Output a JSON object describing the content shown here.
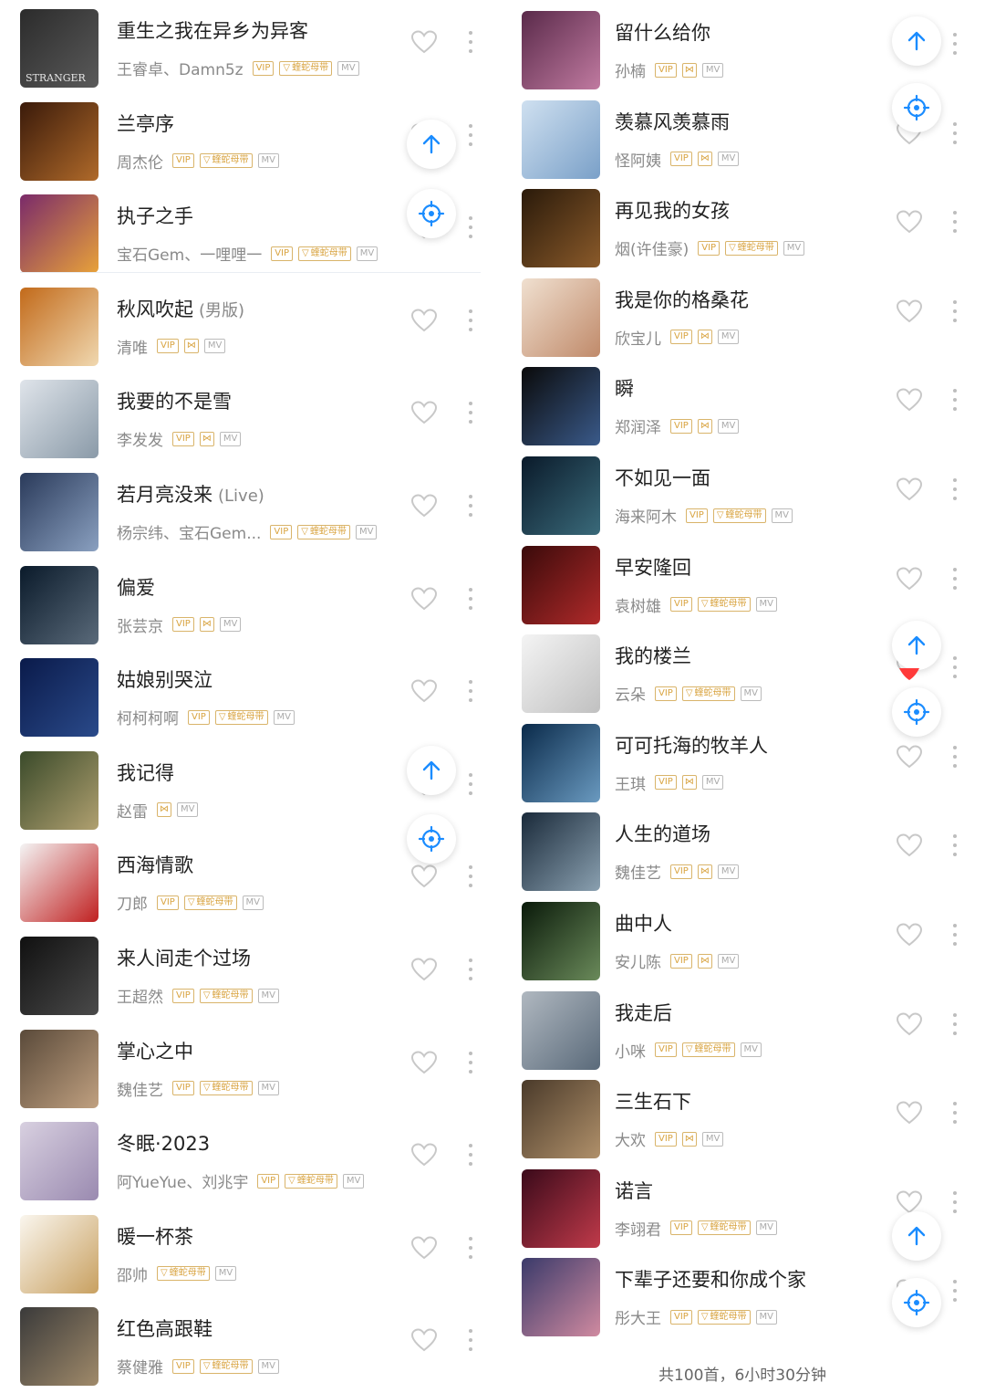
{
  "colors": {
    "accent": "#1a8cff",
    "title": "#222222",
    "artist": "#8a8a8a",
    "vip_tag": "#d9a441",
    "mv_tag": "#aaaaaa",
    "heart_liked": "#ff3a3a"
  },
  "left_songs": [
    {
      "title": "重生之我在异乡为异客",
      "subtitle": "",
      "artist": "王睿卓、Damn5z",
      "tags": [
        "VIP",
        "蝰蛇母带",
        "MV"
      ],
      "cover_colors": [
        "#2b2b2b",
        "#5a5a5a"
      ],
      "cover_text": "STRANGER"
    },
    {
      "title": "兰亭序",
      "subtitle": "",
      "artist": "周杰伦",
      "tags": [
        "VIP",
        "蝰蛇母带",
        "MV"
      ],
      "cover_colors": [
        "#3a1a0a",
        "#b06a2a"
      ],
      "cover_text": ""
    },
    {
      "title": "执子之手",
      "subtitle": "",
      "artist": "宝石Gem、一哩哩一",
      "tags": [
        "VIP",
        "蝰蛇母带",
        "MV"
      ],
      "cover_colors": [
        "#7a2a6a",
        "#e8a23a"
      ],
      "cover_text": ""
    },
    {
      "title": "秋风吹起",
      "subtitle": "(男版)",
      "artist": "清唯",
      "tags": [
        "VIP",
        "HQ",
        "MV"
      ],
      "cover_colors": [
        "#c26a1a",
        "#f0d8b0"
      ],
      "cover_text": ""
    },
    {
      "title": "我要的不是雪",
      "subtitle": "",
      "artist": "李发发",
      "tags": [
        "VIP",
        "HQ",
        "MV"
      ],
      "cover_colors": [
        "#dfe4ea",
        "#8a9aa8"
      ],
      "cover_text": ""
    },
    {
      "title": "若月亮没来",
      "subtitle": "(Live)",
      "artist": "杨宗纬、宝石Gem...",
      "tags": [
        "VIP",
        "蝰蛇母带",
        "MV"
      ],
      "cover_colors": [
        "#2a3a5a",
        "#8aa0c0"
      ],
      "cover_text": ""
    },
    {
      "title": "偏爱",
      "subtitle": "",
      "artist": "张芸京",
      "tags": [
        "VIP",
        "HQ",
        "MV"
      ],
      "cover_colors": [
        "#0a1a2a",
        "#5a6a7a"
      ],
      "cover_text": ""
    },
    {
      "title": "姑娘别哭泣",
      "subtitle": "",
      "artist": "柯柯柯啊",
      "tags": [
        "VIP",
        "蝰蛇母带",
        "MV"
      ],
      "cover_colors": [
        "#0a1a4a",
        "#2a4a8a"
      ],
      "cover_text": ""
    },
    {
      "title": "我记得",
      "subtitle": "",
      "artist": "赵雷",
      "tags": [
        "HQ",
        "MV"
      ],
      "cover_colors": [
        "#3a4a2a",
        "#b0a070"
      ],
      "cover_text": ""
    },
    {
      "title": "西海情歌",
      "subtitle": "",
      "artist": "刀郎",
      "tags": [
        "VIP",
        "蝰蛇母带",
        "MV"
      ],
      "cover_colors": [
        "#f4f4f4",
        "#c02020"
      ],
      "cover_text": ""
    },
    {
      "title": "来人间走个过场",
      "subtitle": "",
      "artist": "王超然",
      "tags": [
        "VIP",
        "蝰蛇母带",
        "MV"
      ],
      "cover_colors": [
        "#101010",
        "#4a4a4a"
      ],
      "cover_text": ""
    },
    {
      "title": "掌心之中",
      "subtitle": "",
      "artist": "魏佳艺",
      "tags": [
        "VIP",
        "蝰蛇母带",
        "MV"
      ],
      "cover_colors": [
        "#5a4a3a",
        "#c0a080"
      ],
      "cover_text": ""
    },
    {
      "title": "冬眠·2023",
      "subtitle": "",
      "artist": "阿YueYue、刘兆宇",
      "tags": [
        "VIP",
        "蝰蛇母带",
        "MV"
      ],
      "cover_colors": [
        "#d8d0e0",
        "#9a8ab0"
      ],
      "cover_text": ""
    },
    {
      "title": "暖一杯茶",
      "subtitle": "",
      "artist": "邵帅",
      "tags": [
        "蝰蛇母带",
        "MV"
      ],
      "cover_colors": [
        "#faf6ee",
        "#c8a060"
      ],
      "cover_text": ""
    },
    {
      "title": "红色高跟鞋",
      "subtitle": "",
      "artist": "蔡健雅",
      "tags": [
        "VIP",
        "蝰蛇母带",
        "MV"
      ],
      "cover_colors": [
        "#3a3a3a",
        "#a08a6a"
      ],
      "cover_text": ""
    }
  ],
  "right_songs": [
    {
      "title": "留什么给你",
      "subtitle": "",
      "artist": "孙楠",
      "tags": [
        "VIP",
        "HQ",
        "MV"
      ],
      "cover_colors": [
        "#5a2a4a",
        "#c07aa0"
      ],
      "cover_text": ""
    },
    {
      "title": "羡慕风羡慕雨",
      "subtitle": "",
      "artist": "怪阿姨",
      "tags": [
        "VIP",
        "HQ",
        "MV"
      ],
      "cover_colors": [
        "#cfe0f0",
        "#7aa0c8"
      ],
      "cover_text": ""
    },
    {
      "title": "再见我的女孩",
      "subtitle": "",
      "artist": "烟(许佳豪)",
      "tags": [
        "VIP",
        "蝰蛇母带",
        "MV"
      ],
      "cover_colors": [
        "#2a1a0a",
        "#8a5a2a"
      ],
      "cover_text": ""
    },
    {
      "title": "我是你的格桑花",
      "subtitle": "",
      "artist": "欣宝儿",
      "tags": [
        "VIP",
        "HQ",
        "MV"
      ],
      "cover_colors": [
        "#f0e0d0",
        "#c08a6a"
      ],
      "cover_text": ""
    },
    {
      "title": "瞬",
      "subtitle": "",
      "artist": "郑润泽",
      "tags": [
        "VIP",
        "HQ",
        "MV"
      ],
      "cover_colors": [
        "#0a0a0a",
        "#3a5a8a"
      ],
      "cover_text": ""
    },
    {
      "title": "不如见一面",
      "subtitle": "",
      "artist": "海来阿木",
      "tags": [
        "VIP",
        "蝰蛇母带",
        "MV"
      ],
      "cover_colors": [
        "#0a1a2a",
        "#3a6a7a"
      ],
      "cover_text": ""
    },
    {
      "title": "早安隆回",
      "subtitle": "",
      "artist": "袁树雄",
      "tags": [
        "VIP",
        "蝰蛇母带",
        "MV"
      ],
      "cover_colors": [
        "#3a0a0a",
        "#b02a2a"
      ],
      "cover_text": ""
    },
    {
      "title": "我的楼兰",
      "subtitle": "",
      "artist": "云朵",
      "tags": [
        "VIP",
        "蝰蛇母带",
        "MV"
      ],
      "cover_colors": [
        "#f4f4f4",
        "#c0c0c0"
      ],
      "cover_text": ""
    },
    {
      "title": "可可托海的牧羊人",
      "subtitle": "",
      "artist": "王琪",
      "tags": [
        "VIP",
        "HQ",
        "MV"
      ],
      "cover_colors": [
        "#0a2a4a",
        "#6a9ac0"
      ],
      "cover_text": ""
    },
    {
      "title": "人生的道场",
      "subtitle": "",
      "artist": "魏佳艺",
      "tags": [
        "VIP",
        "HQ",
        "MV"
      ],
      "cover_colors": [
        "#1a2a3a",
        "#8aa0b0"
      ],
      "cover_text": ""
    },
    {
      "title": "曲中人",
      "subtitle": "",
      "artist": "安儿陈",
      "tags": [
        "VIP",
        "HQ",
        "MV"
      ],
      "cover_colors": [
        "#0a1a0a",
        "#6a8a5a"
      ],
      "cover_text": ""
    },
    {
      "title": "我走后",
      "subtitle": "",
      "artist": "小咪",
      "tags": [
        "VIP",
        "蝰蛇母带",
        "MV"
      ],
      "cover_colors": [
        "#b0b8c0",
        "#5a6a7a"
      ],
      "cover_text": ""
    },
    {
      "title": "三生石下",
      "subtitle": "",
      "artist": "大欢",
      "tags": [
        "VIP",
        "HQ",
        "MV"
      ],
      "cover_colors": [
        "#4a3a2a",
        "#b0906a"
      ],
      "cover_text": ""
    },
    {
      "title": "诺言",
      "subtitle": "",
      "artist": "李翊君",
      "tags": [
        "VIP",
        "蝰蛇母带",
        "MV"
      ],
      "cover_colors": [
        "#3a0a1a",
        "#c03a4a"
      ],
      "cover_text": ""
    },
    {
      "title": "下辈子还要和你成个家",
      "subtitle": "",
      "artist": "彤大王",
      "tags": [
        "VIP",
        "蝰蛇母带",
        "MV"
      ],
      "cover_colors": [
        "#3a3a6a",
        "#d08aa0"
      ],
      "cover_text": ""
    }
  ],
  "summary": "共100首，6小时30分钟"
}
